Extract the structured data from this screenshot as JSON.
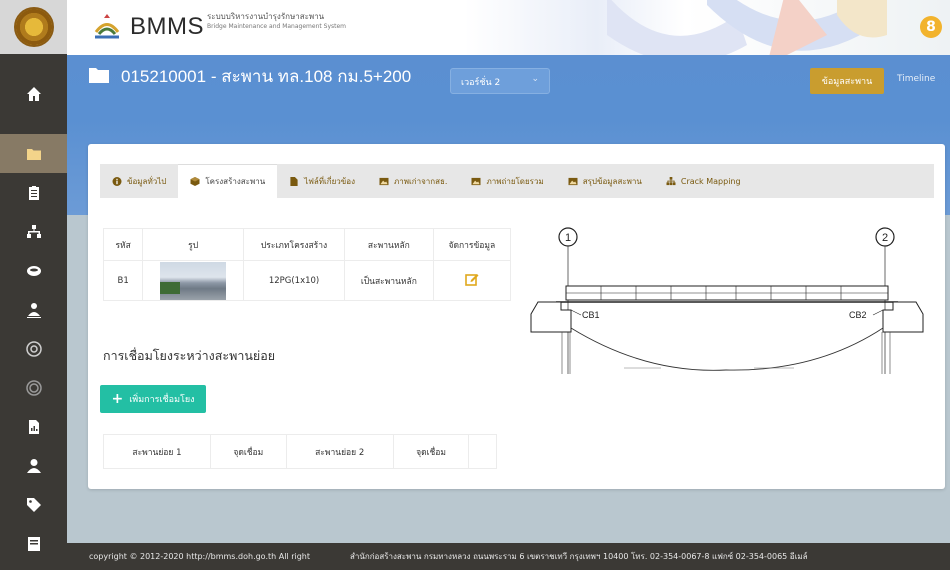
{
  "brand": {
    "title": "BMMS",
    "subtitle_th": "ระบบบริหารงานบำรุงรักษาสะพาน",
    "subtitle_en": "Bridge Maintenance and Management System"
  },
  "user": {
    "initial": "8"
  },
  "sidebar": {
    "items": [
      {
        "icon": "home-icon"
      },
      {
        "icon": "folder-icon",
        "active": true
      },
      {
        "icon": "clipboard-icon"
      },
      {
        "icon": "hierarchy-icon"
      },
      {
        "icon": "database-icon"
      },
      {
        "icon": "users-icon"
      },
      {
        "icon": "link-icon"
      },
      {
        "icon": "circle-icon"
      },
      {
        "icon": "report-icon"
      },
      {
        "icon": "user-icon"
      },
      {
        "icon": "tag-icon"
      },
      {
        "icon": "book-icon"
      }
    ]
  },
  "header": {
    "title": "015210001 - สะพาน ทล.108 กม.5+200",
    "version_label": "เวอร์ชั่น 2",
    "info_button": "ข้อมูลสะพาน",
    "timeline_button": "Timeline"
  },
  "tabs": [
    {
      "label": "ข้อมูลทั่วไป",
      "icon": "info-icon"
    },
    {
      "label": "โครงสร้างสะพาน",
      "icon": "cube-icon",
      "active": true
    },
    {
      "label": "ไฟล์ที่เกี่ยวข้อง",
      "icon": "file-icon"
    },
    {
      "label": "ภาพเก่าจากสธ.",
      "icon": "image-icon"
    },
    {
      "label": "ภาพถ่ายโดยรวม",
      "icon": "image-icon"
    },
    {
      "label": "สรุปข้อมูลสะพาน",
      "icon": "image-icon"
    },
    {
      "label": "Crack Mapping",
      "icon": "sitemap-icon"
    }
  ],
  "structure_table": {
    "headers": [
      "รหัส",
      "รูป",
      "ประเภทโครงสร้าง",
      "สะพานหลัก",
      "จัดการข้อมูล"
    ],
    "rows": [
      {
        "code": "B1",
        "type": "12PG(1x10)",
        "main": "เป็นสะพานหลัก"
      }
    ]
  },
  "connection": {
    "title": "การเชื่อมโยงระหว่างสะพานย่อย",
    "add_button": "เพิ่มการเชื่อมโยง",
    "headers": [
      "สะพานย่อย 1",
      "จุดเชื่อม",
      "สะพานย่อย 2",
      "จุดเชื่อม",
      ""
    ]
  },
  "diagram": {
    "marker_left": "1",
    "marker_right": "2",
    "label_left": "CB1",
    "label_right": "CB2"
  },
  "footer": {
    "copyright": "copyright © 2012-2020 http://bmms.doh.go.th All right",
    "address": "สำนักก่อสร้างสะพาน กรมทางหลวง ถนนพระราม 6 เขตราชเทวี กรุงเทพฯ 10400 โทร. 02-354-0067-8 แฟกซ์ 02-354-0065 อีเมล์"
  }
}
